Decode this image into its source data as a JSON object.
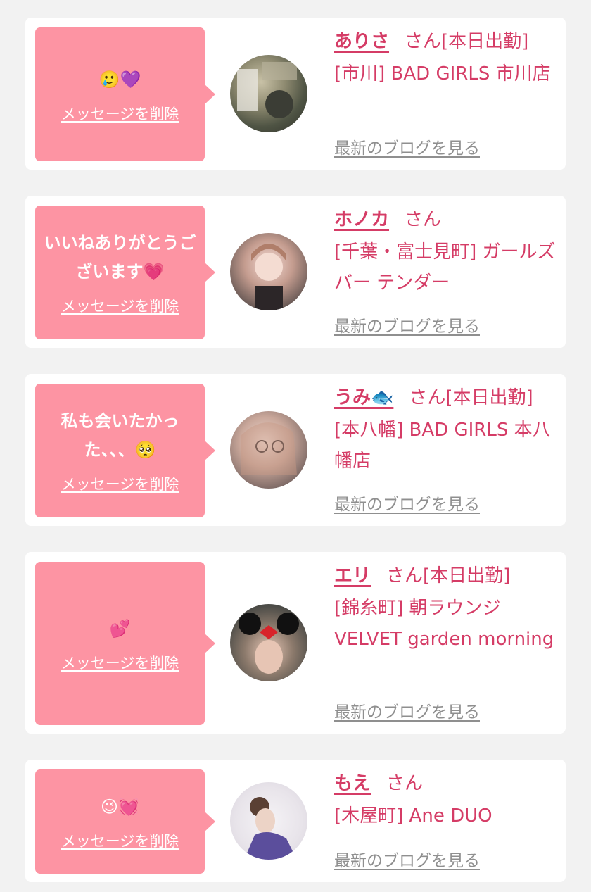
{
  "delete_label": "メッセージを削除",
  "blog_label": "最新のブログを見る",
  "cards": [
    {
      "message": "🥲💜",
      "name": "ありさ",
      "suffix": "さん[本日出勤]",
      "shop": "[市川] BAD GIRLS 市川店"
    },
    {
      "message": "いいねありがとうございます💗",
      "name": "ホノカ",
      "suffix": "さん",
      "shop": "[千葉・富士見町] ガールズバー テンダー"
    },
    {
      "message": "私も会いたかった、、、🥺",
      "name": "うみ🐟",
      "suffix": "さん[本日出勤]",
      "shop": "[本八幡] BAD GIRLS 本八幡店"
    },
    {
      "message": "💕",
      "name": "エリ",
      "suffix": "さん[本日出勤]",
      "shop": "[錦糸町] 朝ラウンジ VELVET garden morning"
    },
    {
      "message": "😉💓",
      "name": "もえ",
      "suffix": "さん",
      "shop": "[木屋町] Ane DUO"
    }
  ],
  "colors": {
    "background": "#f2f2f2",
    "card": "#ffffff",
    "bubble": "#fd94a3",
    "accent": "#d53c66",
    "link_gray": "#8f8f8f"
  }
}
